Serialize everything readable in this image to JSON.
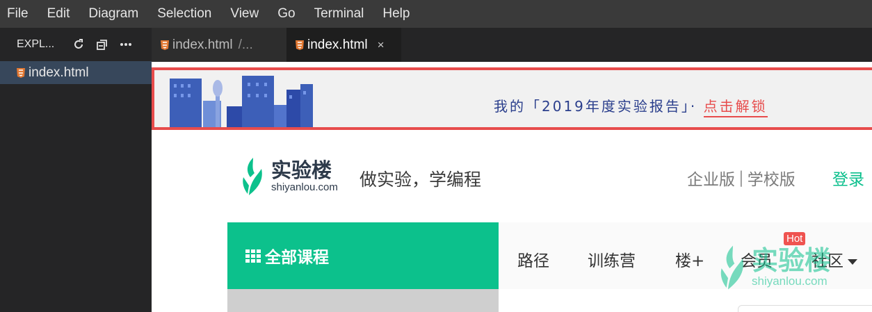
{
  "menu": [
    "File",
    "Edit",
    "Diagram",
    "Selection",
    "View",
    "Go",
    "Terminal",
    "Help"
  ],
  "sidebar": {
    "title": "EXPL...",
    "file": "index.html"
  },
  "tabs": [
    {
      "label": "index.html",
      "path": "/..."
    },
    {
      "label": "index.html",
      "close": "×"
    }
  ],
  "preview": {
    "banner": {
      "text": "我的「2019年度实验报告」· ",
      "cta": "点击解锁"
    },
    "logo": {
      "cn": "实验楼",
      "en": "shiyanlou.com"
    },
    "slogan": "做实验，学编程",
    "top_right": {
      "enterprise": "企业版",
      "sep": "|",
      "school": "学校版",
      "login": "登录"
    },
    "nav": {
      "all_courses": "全部课程",
      "links": [
        "路径",
        "训练营",
        "楼+",
        "会员",
        "社区"
      ],
      "hot": "Hot"
    },
    "watermark": {
      "cn": "实验楼",
      "en": "shiyanlou.com"
    }
  },
  "colors": {
    "brand_green": "#0cc18c",
    "banner_red": "#e74c4c",
    "banner_blue": "#2a3e8c"
  }
}
